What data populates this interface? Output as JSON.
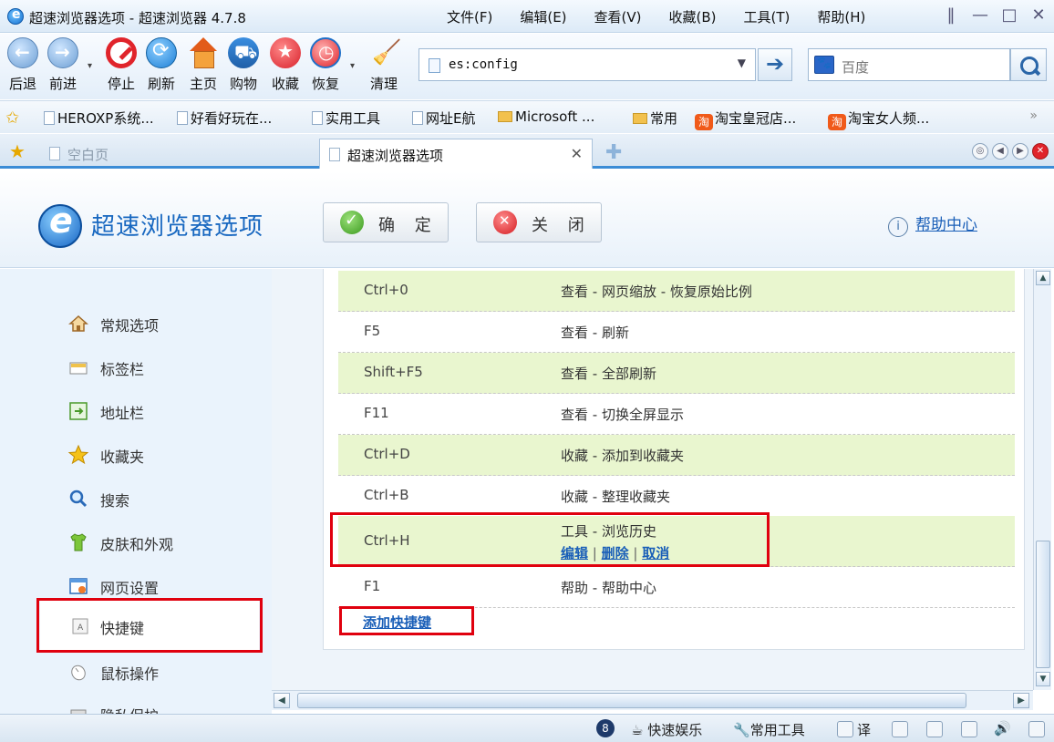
{
  "window": {
    "title": "超速浏览器选项 - 超速浏览器 4.7.8",
    "menus": [
      "文件(F)",
      "编辑(E)",
      "查看(V)",
      "收藏(B)",
      "工具(T)",
      "帮助(H)"
    ],
    "controls": [
      "‖",
      "—",
      "□",
      "✕"
    ]
  },
  "toolbar": {
    "back": "后退",
    "forward": "前进",
    "stop": "停止",
    "refresh": "刷新",
    "home": "主页",
    "shopping": "购物",
    "favorites": "收藏",
    "restore": "恢复",
    "clean": "清理",
    "address_value": "es:config",
    "search_placeholder": "百度"
  },
  "bookmarks": [
    {
      "label": "HEROXP系统...",
      "icon": "page-icon"
    },
    {
      "label": "好看好玩在...",
      "icon": "page-icon"
    },
    {
      "label": "实用工具",
      "icon": "page-icon"
    },
    {
      "label": "网址E航",
      "icon": "page-icon"
    },
    {
      "label": "Microsoft ...",
      "icon": "folder-icon"
    },
    {
      "label": "常用",
      "icon": "folder-icon"
    },
    {
      "label": "淘宝皇冠店...",
      "icon": "taobao-icon"
    },
    {
      "label": "淘宝女人频...",
      "icon": "taobao-icon"
    }
  ],
  "bookmarks_more": "»",
  "tabs": [
    {
      "label": "空白页",
      "active": false
    },
    {
      "label": "超速浏览器选项",
      "active": true
    }
  ],
  "tab_close": "✕",
  "options": {
    "title": "超速浏览器选项",
    "ok_label": "确 定",
    "close_label": "关 闭",
    "help_label": "帮助中心"
  },
  "sidebar": {
    "items": [
      {
        "label": "常规选项",
        "icon": "home-icon"
      },
      {
        "label": "标签栏",
        "icon": "tab-icon"
      },
      {
        "label": "地址栏",
        "icon": "address-icon"
      },
      {
        "label": "收藏夹",
        "icon": "star-icon"
      },
      {
        "label": "搜索",
        "icon": "search-icon"
      },
      {
        "label": "皮肤和外观",
        "icon": "shirt-icon"
      },
      {
        "label": "网页设置",
        "icon": "webpage-icon"
      },
      {
        "label": "快捷键",
        "icon": "keyboard-icon",
        "active": true
      },
      {
        "label": "鼠标操作",
        "icon": "mouse-icon"
      },
      {
        "label": "隐私保护",
        "icon": "privacy-icon"
      }
    ]
  },
  "shortcuts": {
    "rows": [
      {
        "key": "Ctrl+0",
        "action": "查看  - 网页缩放  - 恢复原始比例"
      },
      {
        "key": "F5",
        "action": "查看  - 刷新"
      },
      {
        "key": "Shift+F5",
        "action": "查看  - 全部刷新"
      },
      {
        "key": "F11",
        "action": "查看  - 切换全屏显示"
      },
      {
        "key": "Ctrl+D",
        "action": "收藏  - 添加到收藏夹"
      },
      {
        "key": "Ctrl+B",
        "action": "收藏  - 整理收藏夹"
      },
      {
        "key": "Ctrl+H",
        "action": "工具  - 浏览历史"
      },
      {
        "key": "F1",
        "action": "帮助  - 帮助中心"
      }
    ],
    "row_links": {
      "edit": "编辑",
      "delete": "删除",
      "cancel": "取消"
    },
    "add_label": "添加快捷键"
  },
  "statusbar": {
    "entertainment": "快速娱乐",
    "tools": "常用工具",
    "translate": "译"
  },
  "colors": {
    "accent": "#1767c0",
    "row_highlight": "#e9f6cf",
    "annotation_red": "#e0000e"
  }
}
